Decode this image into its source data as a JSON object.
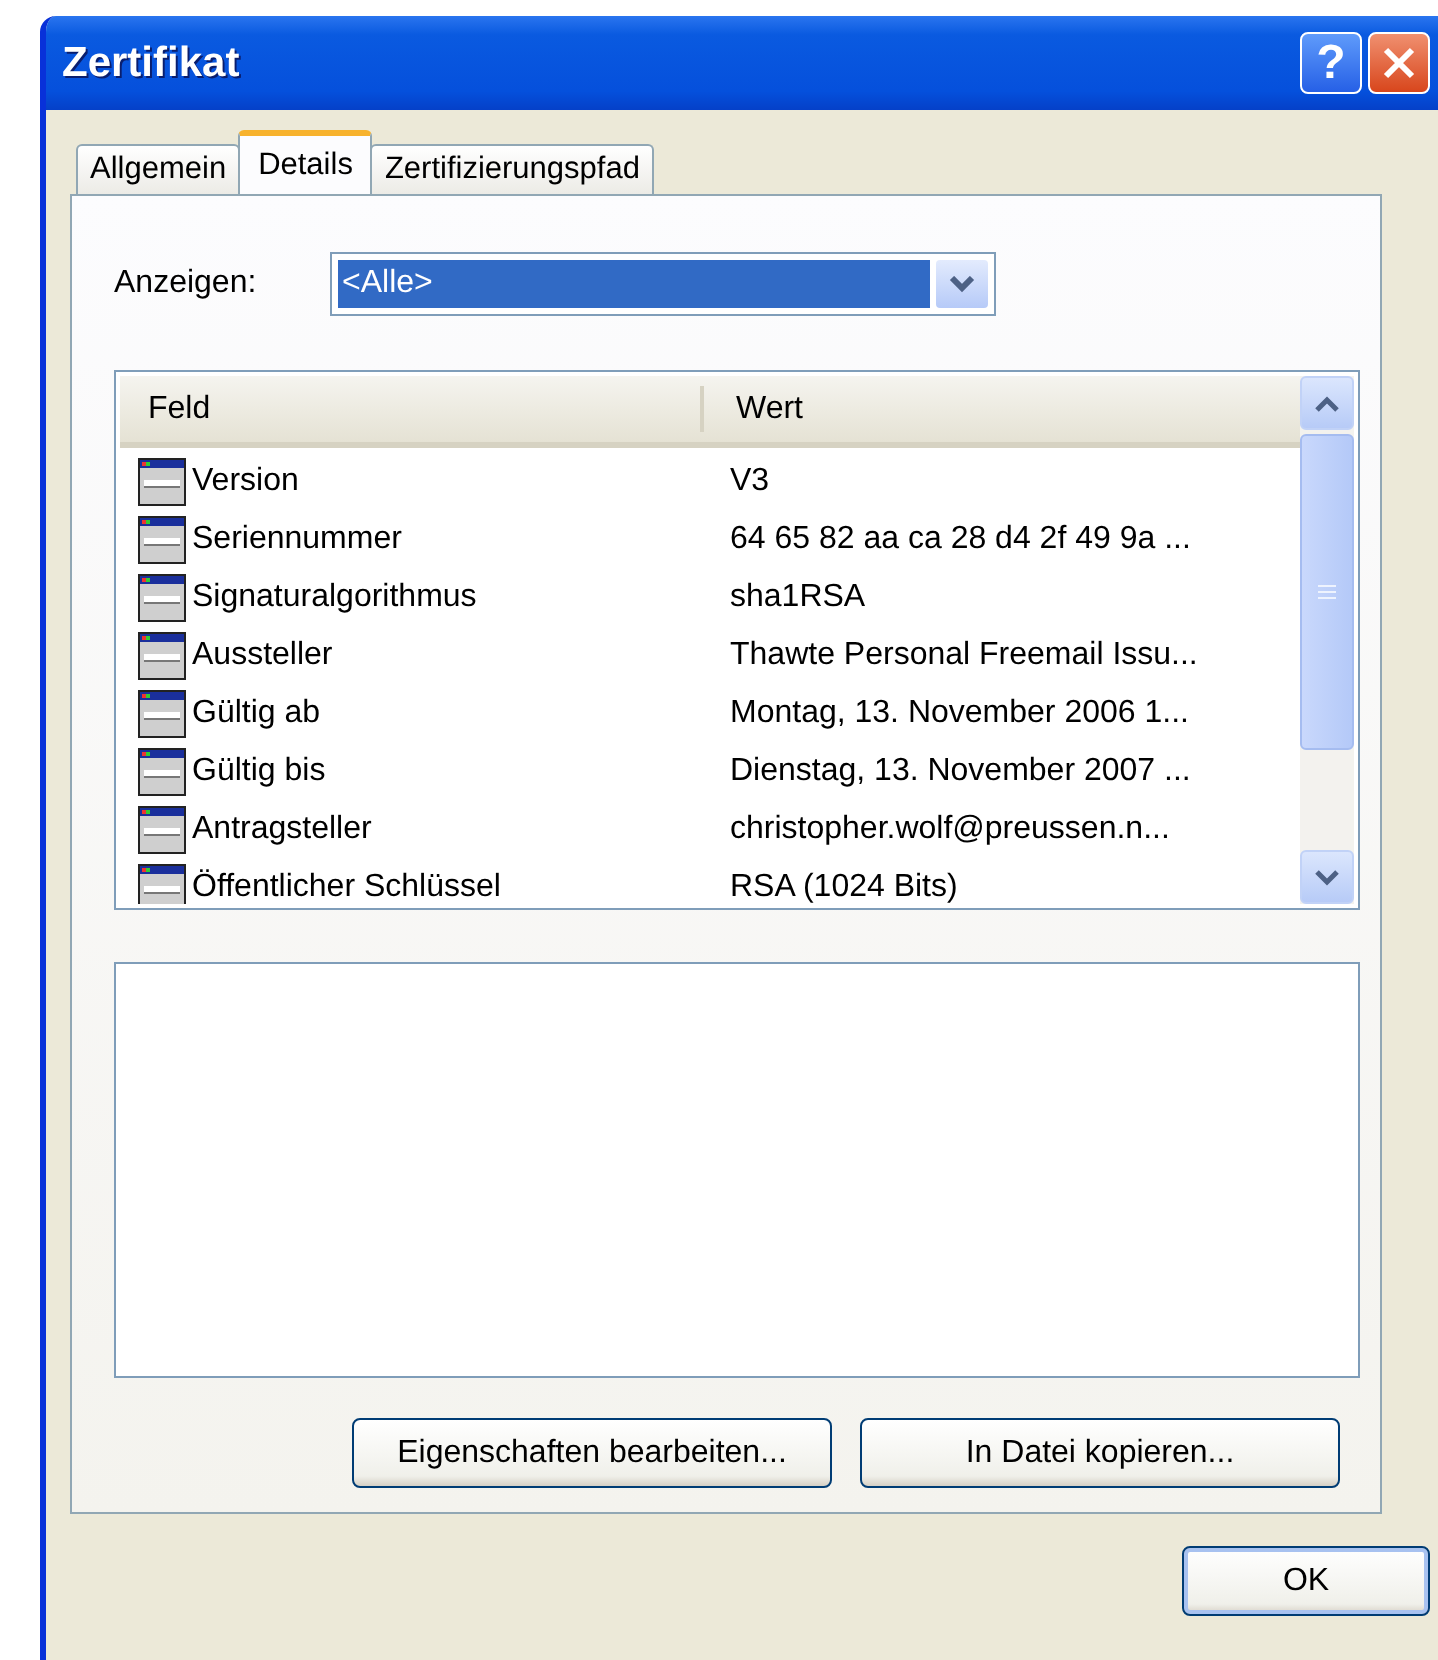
{
  "window": {
    "title": "Zertifikat",
    "help_button": "?"
  },
  "tabs": [
    {
      "label": "Allgemein",
      "selected": false
    },
    {
      "label": "Details",
      "selected": true
    },
    {
      "label": "Zertifizierungspfad",
      "selected": false
    }
  ],
  "show": {
    "label": "Anzeigen:",
    "value": "<Alle>"
  },
  "list": {
    "columns": [
      "Feld",
      "Wert"
    ],
    "rows": [
      {
        "field": "Version",
        "value": "V3"
      },
      {
        "field": "Seriennummer",
        "value": "64 65 82 aa ca 28 d4 2f 49 9a ..."
      },
      {
        "field": "Signaturalgorithmus",
        "value": "sha1RSA"
      },
      {
        "field": "Aussteller",
        "value": "Thawte Personal Freemail Issu..."
      },
      {
        "field": "Gültig ab",
        "value": "Montag, 13. November 2006 1..."
      },
      {
        "field": "Gültig bis",
        "value": "Dienstag, 13. November 2007 ..."
      },
      {
        "field": "Antragsteller",
        "value": "christopher.wolf@preussen.n..."
      },
      {
        "field": "Öffentlicher Schlüssel",
        "value": "RSA (1024 Bits)"
      }
    ]
  },
  "buttons": [
    "Eigenschaften bearbeiten...",
    "In Datei kopieren..."
  ],
  "ok_button": "OK"
}
